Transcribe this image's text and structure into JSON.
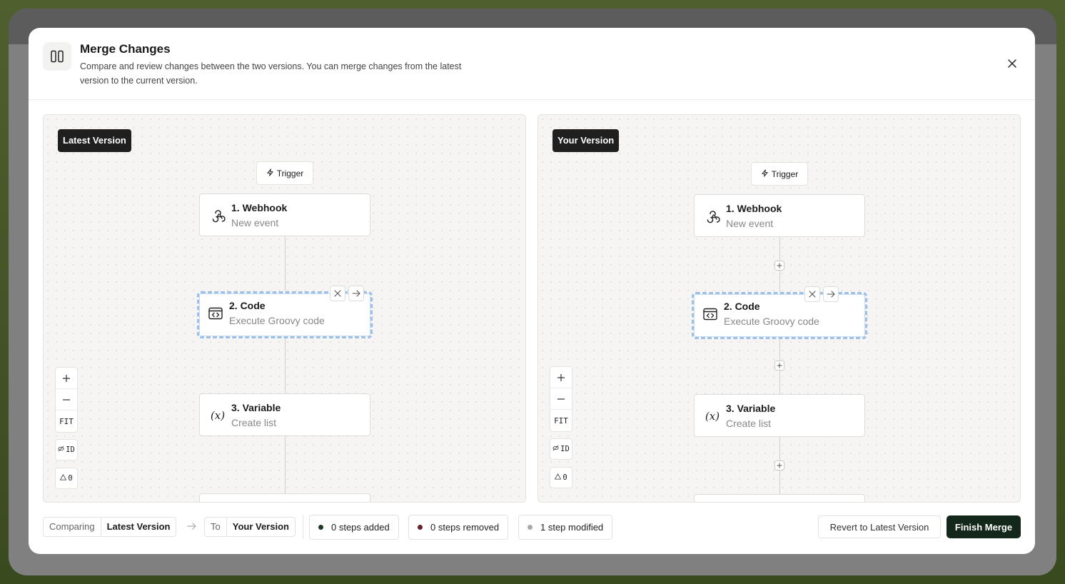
{
  "modal": {
    "title": "Merge Changes",
    "subtitle": "Compare and review changes between the two versions. You can merge changes from the latest version to the current version."
  },
  "left_panel": {
    "label": "Latest Version",
    "trigger": "Trigger",
    "nodes": [
      {
        "title": "1. Webhook",
        "subtitle": "New event",
        "icon": "webhook-icon"
      },
      {
        "title": "2. Code",
        "subtitle": "Execute Groovy code",
        "icon": "code-icon"
      },
      {
        "title": "3. Variable",
        "subtitle": "Create list",
        "icon": "variable-icon"
      }
    ],
    "zoom": {
      "fit": "FIT",
      "id": "ID",
      "warnings": "0"
    }
  },
  "right_panel": {
    "label": "Your Version",
    "trigger": "Trigger",
    "nodes": [
      {
        "title": "1. Webhook",
        "subtitle": "New event",
        "icon": "webhook-icon"
      },
      {
        "title": "2. Code",
        "subtitle": "Execute Groovy code",
        "icon": "code-icon"
      },
      {
        "title": "3. Variable",
        "subtitle": "Create list",
        "icon": "variable-icon"
      }
    ],
    "zoom": {
      "fit": "FIT",
      "id": "ID",
      "warnings": "0"
    }
  },
  "footer": {
    "comparing_label": "Comparing",
    "comparing_value": "Latest Version",
    "to_label": "To",
    "to_value": "Your Version",
    "stats": [
      {
        "text": "0 steps added",
        "color": "#1f3a1f"
      },
      {
        "text": "0 steps removed",
        "color": "#6b1f2a"
      },
      {
        "text": "1 step modified",
        "color": "#a8a8a8"
      }
    ],
    "revert_label": "Revert to Latest Version",
    "finish_label": "Finish Merge"
  },
  "colors": {
    "accent": "#13281a",
    "selected_border": "#9cc0ea"
  }
}
